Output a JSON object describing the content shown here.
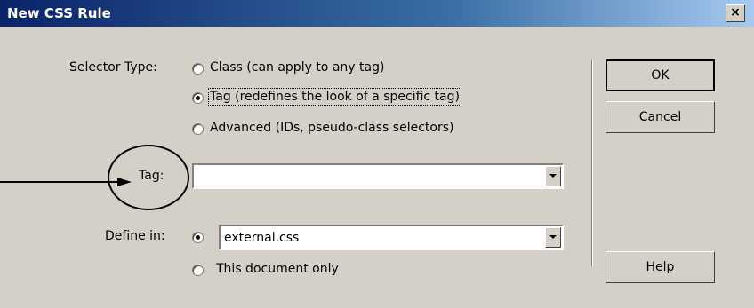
{
  "window": {
    "title": "New CSS Rule",
    "close_label": "×"
  },
  "selector_type": {
    "label": "Selector Type:",
    "options": [
      {
        "label": "Class (can apply to any tag)",
        "selected": false
      },
      {
        "label": "Tag (redefines the look of a specific tag)",
        "selected": true
      },
      {
        "label": "Advanced (IDs, pseudo-class selectors)",
        "selected": false
      }
    ]
  },
  "tag": {
    "label": "Tag:",
    "value": ""
  },
  "define_in": {
    "label": "Define in:",
    "file_value": "external.css",
    "doc_only_label": "This document only"
  },
  "buttons": {
    "ok": "OK",
    "cancel": "Cancel",
    "help": "Help"
  }
}
